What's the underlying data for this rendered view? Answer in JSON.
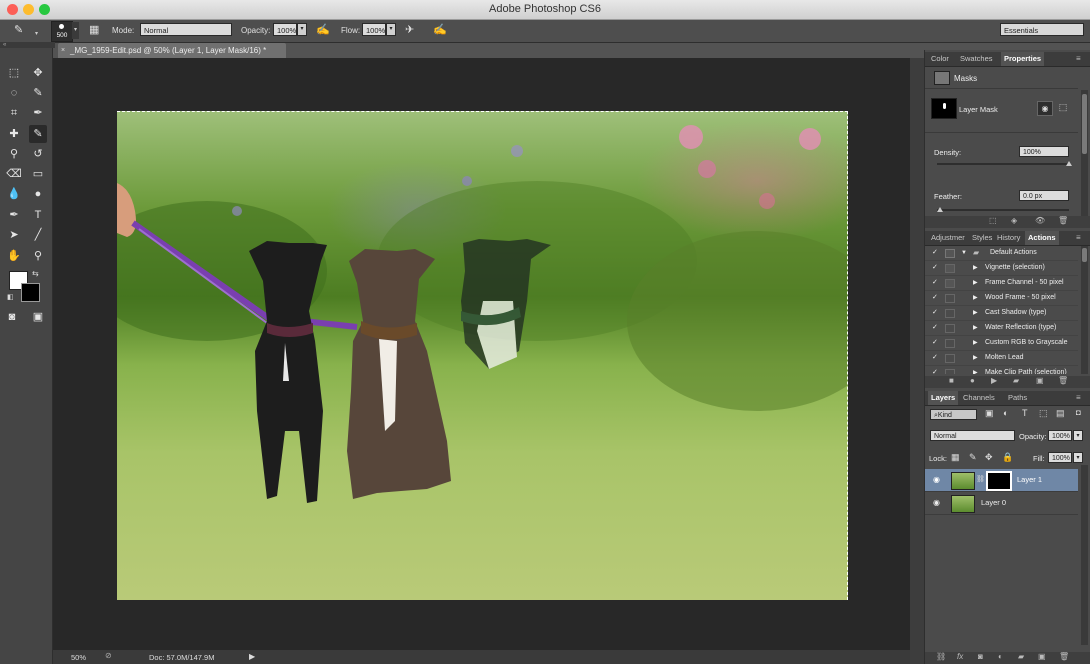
{
  "window": {
    "title": "Adobe Photoshop CS6"
  },
  "options_bar": {
    "brush_size": "500",
    "mode_label": "Mode:",
    "mode_value": "Normal",
    "opacity_label": "Opacity:",
    "opacity_value": "100%",
    "flow_label": "Flow:",
    "flow_value": "100%",
    "workspace": "Essentials"
  },
  "document": {
    "tab_title": "_MG_1959-Edit.psd @ 50% (Layer 1, Layer Mask/16) *",
    "zoom": "50%",
    "doc_size": "Doc: 57.0M/147.9M"
  },
  "properties_panel": {
    "tabs": [
      "Color",
      "Swatches",
      "Properties"
    ],
    "section": "Masks",
    "mask_name": "Layer Mask",
    "density_label": "Density:",
    "density_value": "100%",
    "density_fraction": 1.0,
    "feather_label": "Feather:",
    "feather_value": "0.0 px",
    "feather_fraction": 0.0
  },
  "actions_panel": {
    "tabs": [
      "Adjustmer",
      "Styles",
      "History",
      "Actions"
    ],
    "set_name": "Default Actions",
    "items": [
      "Vignette (selection)",
      "Frame Channel - 50 pixel",
      "Wood Frame - 50 pixel",
      "Cast Shadow (type)",
      "Water Reflection (type)",
      "Custom RGB to Grayscale",
      "Molten Lead",
      "Make Clip Path (selection)"
    ]
  },
  "layers_panel": {
    "tabs": [
      "Layers",
      "Channels",
      "Paths"
    ],
    "filter_kind": "Kind",
    "blend_mode": "Normal",
    "opacity_label": "Opacity:",
    "opacity_value": "100%",
    "lock_label": "Lock:",
    "fill_label": "Fill:",
    "fill_value": "100%",
    "layers": [
      "Layer 1",
      "Layer 0"
    ],
    "bottom_fx": "fx"
  },
  "colors": {
    "panel_bg": "#4b4b4b",
    "selected_layer": "#6f87a6",
    "canvas_bg": "#282828"
  }
}
